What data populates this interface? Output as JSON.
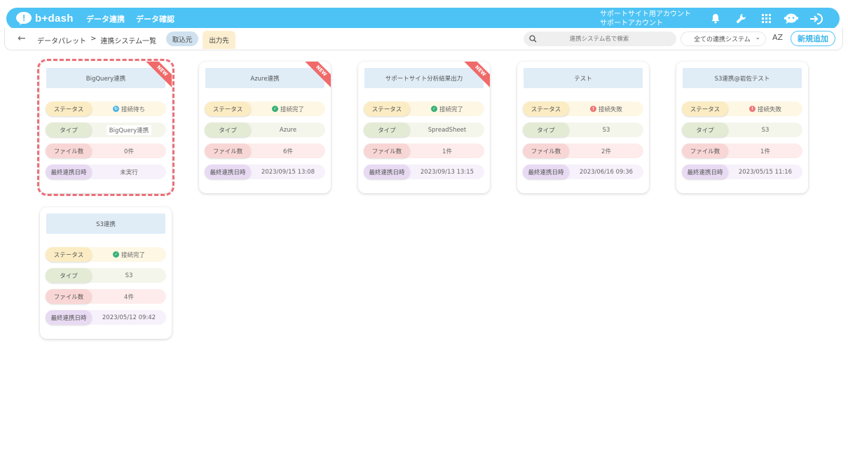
{
  "header": {
    "logo_text": "b+dash",
    "nav": [
      "データ連携",
      "データ確認"
    ],
    "account_line1": "サポートサイト用アカウント",
    "account_line2": "サポートアカウント",
    "icons": [
      "bell-icon",
      "wrench-icon",
      "grid-icon",
      "chat-bot-icon",
      "logout-icon"
    ]
  },
  "subbar": {
    "breadcrumb_root": "データパレット",
    "breadcrumb_sep": ">",
    "breadcrumb_current": "連携システム一覧",
    "tab_import": "取込元",
    "tab_export": "出力先",
    "search_placeholder": "連携システム名で検索",
    "filter_value": "全ての連携システム",
    "sort_label": "AZ",
    "add_button": "新規追加"
  },
  "labels": {
    "status": "ステータス",
    "type": "タイプ",
    "files": "ファイル数",
    "last_sync": "最終連携日時"
  },
  "ribbon_text": "NEW",
  "cards": [
    {
      "title": "BigQuery連携",
      "status": "接続待ち",
      "status_kind": "wait",
      "type": "BigQuery連携",
      "files": "0件",
      "last_sync": "未実行",
      "new": true
    },
    {
      "title": "Azure連携",
      "status": "接続完了",
      "status_kind": "ok",
      "type": "Azure",
      "files": "6件",
      "last_sync": "2023/09/15 13:08",
      "new": true
    },
    {
      "title": "サポートサイト分析結果出力",
      "status": "接続完了",
      "status_kind": "ok",
      "type": "SpreadSheet",
      "files": "1件",
      "last_sync": "2023/09/13 13:15",
      "new": true
    },
    {
      "title": "テスト",
      "status": "接続失敗",
      "status_kind": "err",
      "type": "S3",
      "files": "2件",
      "last_sync": "2023/06/16 09:36",
      "new": false
    },
    {
      "title": "S3連携@岩佐テスト",
      "status": "接続失敗",
      "status_kind": "err",
      "type": "S3",
      "files": "1件",
      "last_sync": "2023/05/15 11:16",
      "new": false
    },
    {
      "title": "S3連携",
      "status": "接続完了",
      "status_kind": "ok",
      "type": "S3",
      "files": "4件",
      "last_sync": "2023/05/12 09:42",
      "new": false
    }
  ],
  "colors": {
    "accent": "#4dc3f5",
    "highlight": "#ec6f78",
    "status_ok": "#38b076",
    "status_err": "#ee7777",
    "status_wait": "#4bb5e5"
  }
}
